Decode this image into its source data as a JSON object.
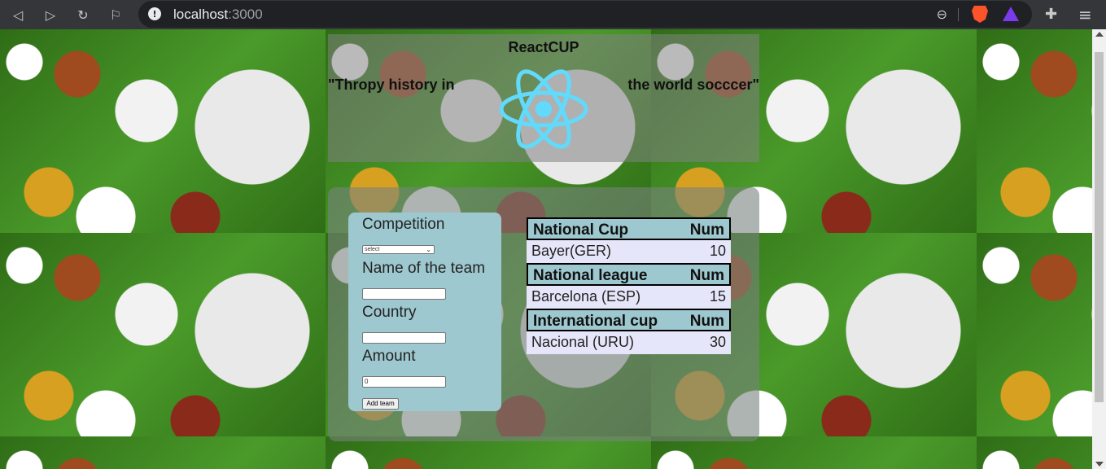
{
  "browser": {
    "url_host": "localhost",
    "url_port": ":3000",
    "info_icon": "info-icon",
    "back_icon": "back-arrow-icon",
    "forward_icon": "forward-arrow-icon",
    "reload_icon": "reload-icon",
    "bookmark_icon": "bookmark-icon"
  },
  "header": {
    "title": "ReactCUP",
    "slogan_left": "\"Thropy history in",
    "slogan_right": "the world socccer\""
  },
  "form": {
    "competition_label": "Competition",
    "competition_selected": "select",
    "team_label": "Name of the team",
    "team_value": "",
    "country_label": "Country",
    "country_value": "",
    "amount_label": "Amount",
    "amount_value": "0",
    "submit_label": "Add team"
  },
  "tables": [
    {
      "header": "National Cup",
      "num_header": "Num",
      "row": {
        "team": "Bayer(GER)",
        "num": "10"
      }
    },
    {
      "header": "National league",
      "num_header": "Num",
      "row": {
        "team": "Barcelona (ESP)",
        "num": "15"
      }
    },
    {
      "header": "International cup",
      "num_header": "Num",
      "row": {
        "team": "Nacional (URU)",
        "num": "30"
      }
    }
  ],
  "colors": {
    "react_logo": "#61dafb",
    "card_bg": "#9ec8cf",
    "row_bg": "#e6e6fa"
  }
}
